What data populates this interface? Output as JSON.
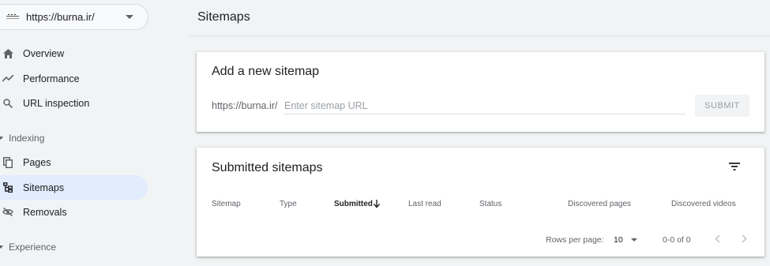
{
  "property": {
    "url": "https://burna.ir/",
    "logo_icon": "site-favicon",
    "dropdown_icon": "caret-down-icon"
  },
  "nav": {
    "items": [
      {
        "label": "Overview",
        "icon": "home-icon"
      },
      {
        "label": "Performance",
        "icon": "trending-up-icon"
      },
      {
        "label": "URL inspection",
        "icon": "search-icon"
      }
    ],
    "indexing": {
      "label": "Indexing",
      "items": [
        {
          "label": "Pages",
          "icon": "pages-icon"
        },
        {
          "label": "Sitemaps",
          "icon": "sitemap-icon",
          "active": true
        },
        {
          "label": "Removals",
          "icon": "visibility-off-icon"
        }
      ]
    },
    "experience": {
      "label": "Experience"
    }
  },
  "page": {
    "title": "Sitemaps"
  },
  "add_sitemap": {
    "title": "Add a new sitemap",
    "prefix": "https://burna.ir/",
    "input_value": "",
    "input_placeholder": "Enter sitemap URL",
    "submit_label": "SUBMIT"
  },
  "submitted": {
    "title": "Submitted sitemaps",
    "filter_icon": "filter-icon",
    "columns": [
      "Sitemap",
      "Type",
      "Submitted",
      "Last read",
      "Status",
      "Discovered pages",
      "Discovered videos"
    ],
    "sort_column": "Submitted",
    "sort_direction": "descending",
    "rows": [],
    "footer": {
      "rows_per_page_label": "Rows per page:",
      "rows_per_page_value": "10",
      "range": "0-0 of 0"
    }
  },
  "colors": {
    "active_nav_bg": "#e1ecfd",
    "page_bg": "#f1f3f4",
    "card_bg": "#ffffff"
  }
}
